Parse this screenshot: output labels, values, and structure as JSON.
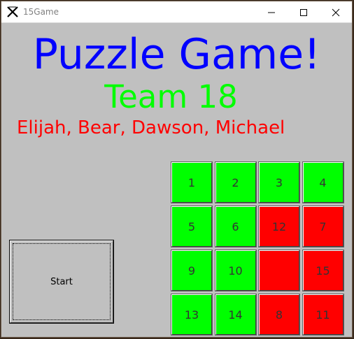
{
  "window": {
    "title": "15Game",
    "app_icon": "x-logo-icon",
    "controls": [
      "minimize-icon",
      "maximize-icon",
      "close-icon"
    ]
  },
  "header": {
    "title": "Puzzle Game!",
    "team": "Team 18",
    "members": "Elijah, Bear, Dawson, Michael"
  },
  "start_button": {
    "label": "Start"
  },
  "colors": {
    "title": "#0000ff",
    "team": "#00ff00",
    "members": "#ff0000",
    "tile_correct": "#00ff00",
    "tile_wrong": "#ff0000",
    "background": "#c0c0c0"
  },
  "board": {
    "rows": [
      [
        {
          "label": "1",
          "state": "correct"
        },
        {
          "label": "2",
          "state": "correct"
        },
        {
          "label": "3",
          "state": "correct"
        },
        {
          "label": "4",
          "state": "correct"
        }
      ],
      [
        {
          "label": "5",
          "state": "correct"
        },
        {
          "label": "6",
          "state": "correct"
        },
        {
          "label": "12",
          "state": "wrong"
        },
        {
          "label": "7",
          "state": "wrong"
        }
      ],
      [
        {
          "label": "9",
          "state": "correct"
        },
        {
          "label": "10",
          "state": "correct"
        },
        {
          "label": "",
          "state": "wrong"
        },
        {
          "label": "15",
          "state": "wrong"
        }
      ],
      [
        {
          "label": "13",
          "state": "correct"
        },
        {
          "label": "14",
          "state": "correct"
        },
        {
          "label": "8",
          "state": "wrong"
        },
        {
          "label": "11",
          "state": "wrong"
        }
      ]
    ]
  }
}
